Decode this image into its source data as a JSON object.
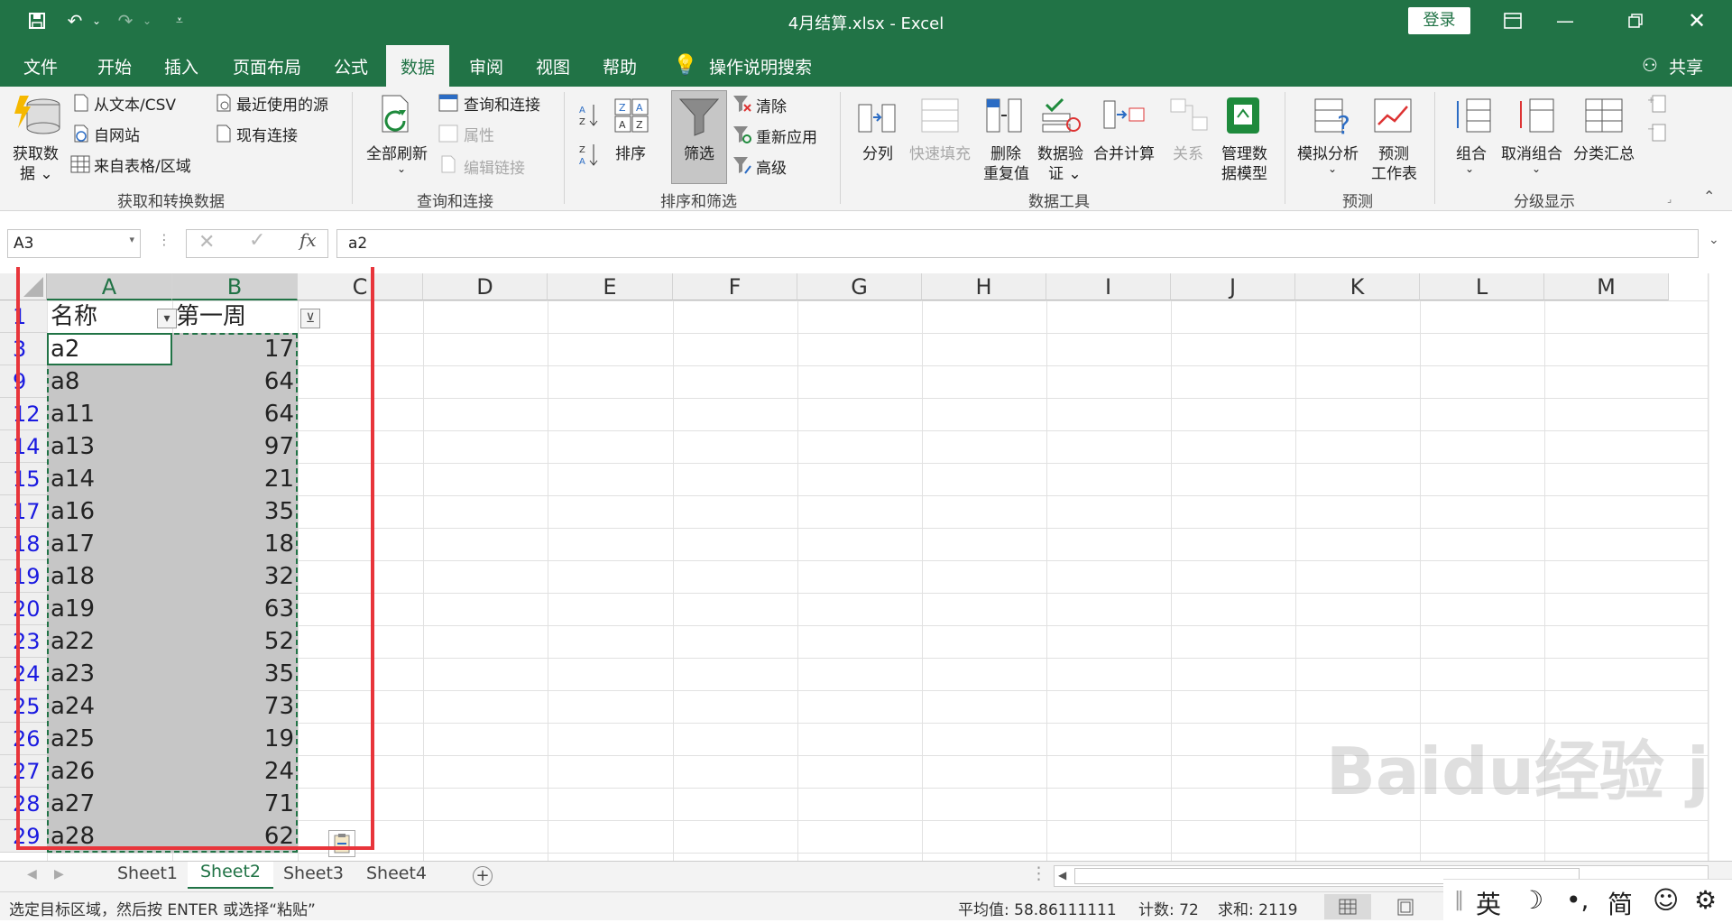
{
  "window": {
    "title": "4月结算.xlsx  -  Excel",
    "login": "登录",
    "share": "共享"
  },
  "tabs": [
    "文件",
    "开始",
    "插入",
    "页面布局",
    "公式",
    "数据",
    "审阅",
    "视图",
    "帮助",
    "操作说明搜索"
  ],
  "ribbon": {
    "get_data": {
      "big": "获取数\n据",
      "big1": "获取数",
      "big2": "据 ⌄",
      "items": [
        "从文本/CSV",
        "自网站",
        "来自表格/区域"
      ],
      "items2": [
        "最近使用的源",
        "现有连接"
      ],
      "label": "获取和转换数据"
    },
    "queries": {
      "refresh": "全部刷新",
      "items": [
        "查询和连接",
        "属性",
        "编辑链接"
      ],
      "label": "查询和连接"
    },
    "sort": {
      "sort": "排序",
      "filter": "筛选",
      "items": [
        "清除",
        "重新应用",
        "高级"
      ],
      "label": "排序和筛选"
    },
    "tools": {
      "items": [
        "分列",
        "快速填充",
        "删除\n重复值",
        "数据验\n证 ⌄",
        "合并计算",
        "关系",
        "管理数\n据模型"
      ],
      "t0": "分列",
      "t1": "快速填充",
      "t2a": "删除",
      "t2b": "重复值",
      "t3a": "数据验",
      "t3b": "证 ⌄",
      "t4": "合并计算",
      "t5": "关系",
      "t6a": "管理数",
      "t6b": "据模型",
      "label": "数据工具"
    },
    "forecast": {
      "what_if": "模拟分析",
      "sheet_a": "预测",
      "sheet_b": "工作表",
      "label": "预测"
    },
    "outline": {
      "group": "组合",
      "ungroup": "取消组合",
      "subtotal": "分类汇总",
      "label": "分级显示"
    }
  },
  "formula_bar": {
    "name_box": "A3",
    "value": "a2",
    "fx": "fx"
  },
  "columns": [
    "A",
    "B",
    "C",
    "D",
    "E",
    "F",
    "G",
    "H",
    "I",
    "J",
    "K",
    "L",
    "M"
  ],
  "header_row": {
    "row": "1",
    "a": "名称",
    "b": "第一周"
  },
  "rows": [
    {
      "row": "3",
      "name": "a2",
      "value": "17"
    },
    {
      "row": "9",
      "name": "a8",
      "value": "64"
    },
    {
      "row": "12",
      "name": "a11",
      "value": "64"
    },
    {
      "row": "14",
      "name": "a13",
      "value": "97"
    },
    {
      "row": "15",
      "name": "a14",
      "value": "21"
    },
    {
      "row": "17",
      "name": "a16",
      "value": "35"
    },
    {
      "row": "18",
      "name": "a17",
      "value": "18"
    },
    {
      "row": "19",
      "name": "a18",
      "value": "32"
    },
    {
      "row": "20",
      "name": "a19",
      "value": "63"
    },
    {
      "row": "23",
      "name": "a22",
      "value": "52"
    },
    {
      "row": "24",
      "name": "a23",
      "value": "35"
    },
    {
      "row": "25",
      "name": "a24",
      "value": "73"
    },
    {
      "row": "26",
      "name": "a25",
      "value": "19"
    },
    {
      "row": "27",
      "name": "a26",
      "value": "24"
    },
    {
      "row": "28",
      "name": "a27",
      "value": "71"
    },
    {
      "row": "29",
      "name": "a28",
      "value": "62"
    }
  ],
  "sheets": [
    "Sheet1",
    "Sheet2",
    "Sheet3",
    "Sheet4"
  ],
  "status": {
    "message": "选定目标区域，然后按 ENTER 或选择“粘贴”",
    "average": "平均值: 58.86111111",
    "count": "计数: 72",
    "sum": "求和: 2119"
  },
  "ime": {
    "lang": "英",
    "mode": "简"
  },
  "watermark": "Baidu经验 jingyan.baidu.com",
  "colors": {
    "excel_green": "#217346",
    "highlight_red": "#e8353b",
    "row_num_blue": "#1a1ae0"
  }
}
